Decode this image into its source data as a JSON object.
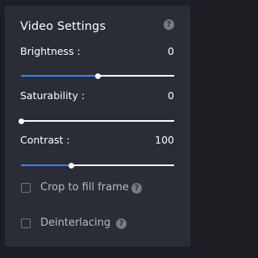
{
  "panel": {
    "title": "Video Settings",
    "help_glyph": "?"
  },
  "sliders": [
    {
      "key": "brightness",
      "label": "Brightness :",
      "value": "0",
      "fraction": 0.5
    },
    {
      "key": "saturability",
      "label": "Saturability :",
      "value": "0",
      "fraction": 0.0
    },
    {
      "key": "contrast",
      "label": "Contrast :",
      "value": "100",
      "fraction": 0.33
    }
  ],
  "options": [
    {
      "key": "crop",
      "label": "Crop to fill frame",
      "checked": false
    },
    {
      "key": "deinterlacing",
      "label": "Deinterlacing",
      "checked": false
    }
  ],
  "colors": {
    "accent": "#3b82f6",
    "panel": "#2a2d35",
    "background": "#1c1e24"
  },
  "icons": {
    "help": "question-circle-icon"
  }
}
